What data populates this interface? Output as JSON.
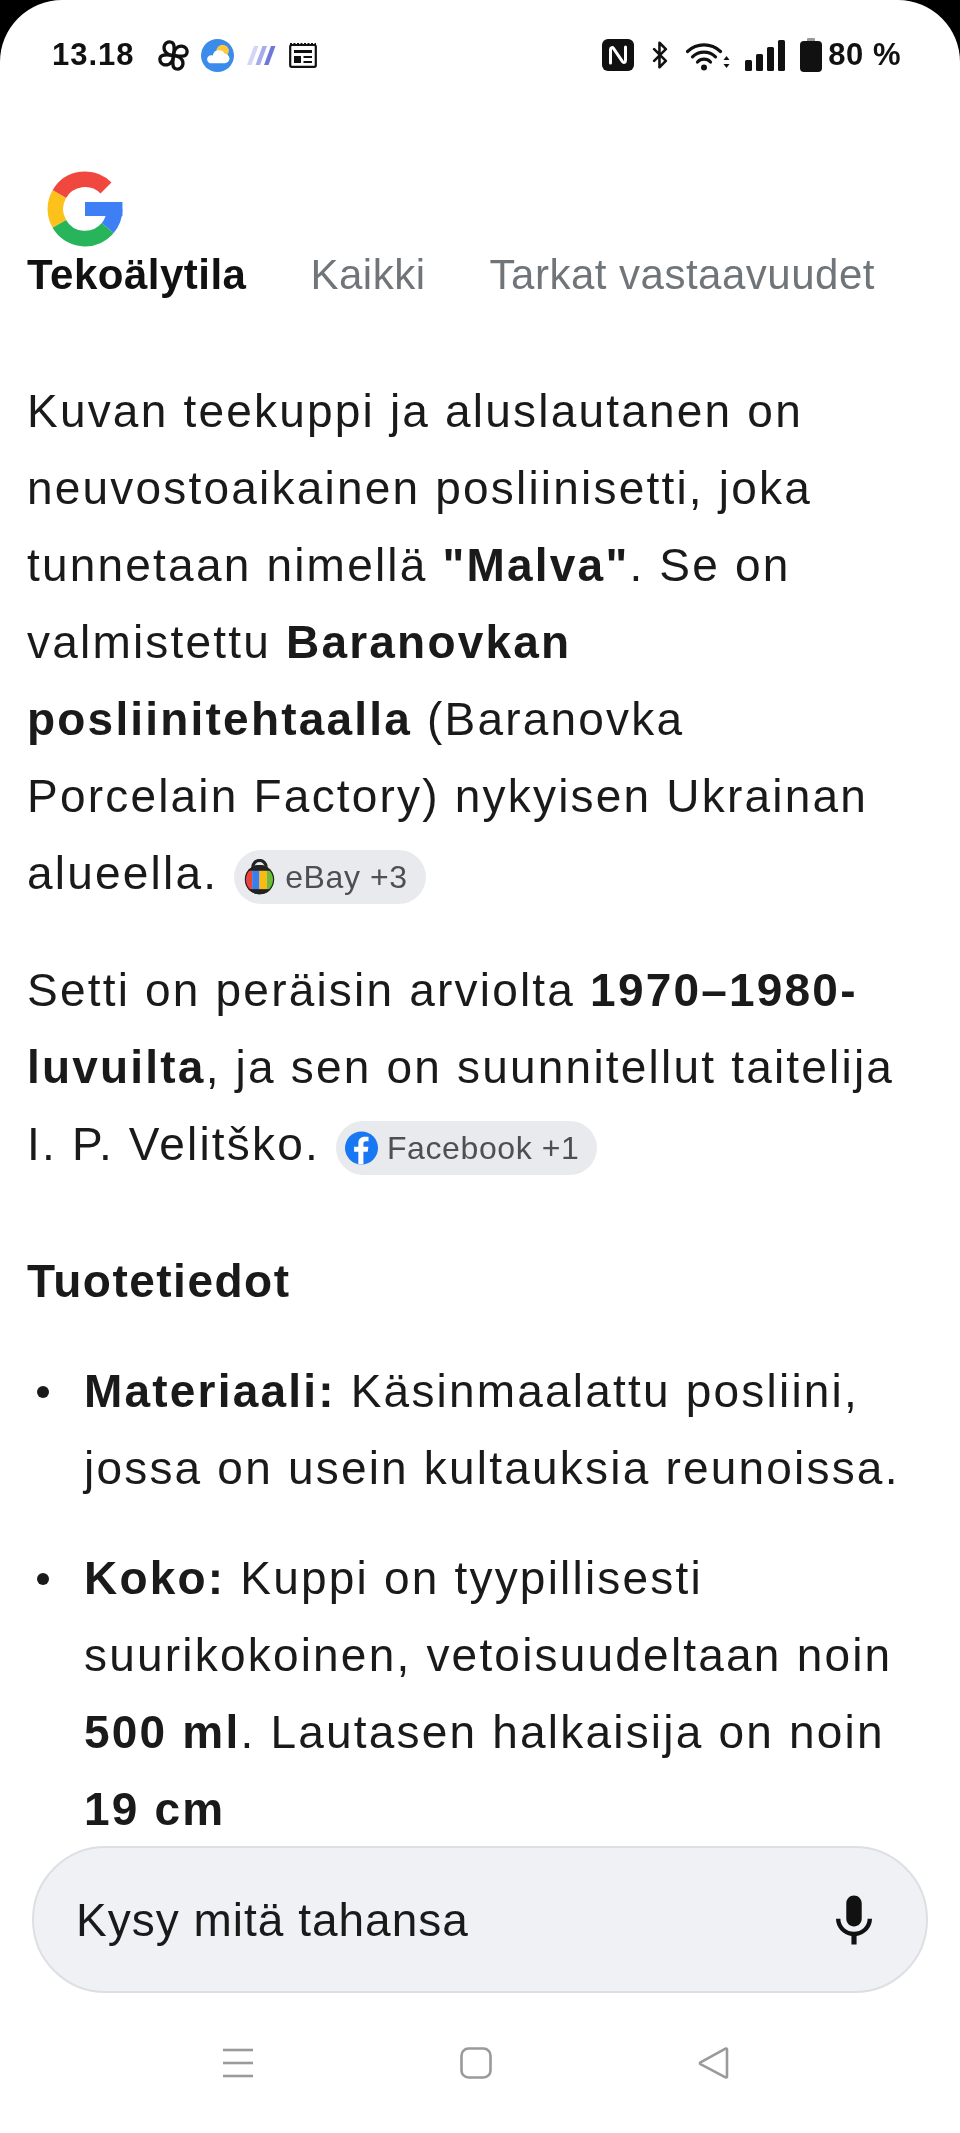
{
  "status_bar": {
    "time": "13.18",
    "battery": "80 %"
  },
  "tabs": [
    {
      "label": "Tekoälytila",
      "selected": true
    },
    {
      "label": "Kaikki",
      "selected": false
    },
    {
      "label": "Tarkat vastaavuudet",
      "selected": false
    }
  ],
  "answer": {
    "paragraphs": [
      {
        "text": "Kuvan teekuppi ja aluslautanen on neuvostoaikainen posliinisetti, joka tunnetaan nimellä **\"Malva\"**. Se on valmistettu **Baranovkan posliinitehtaalla** (Baranovka Porcelain Factory) nykyisen Ukrainan alueella.",
        "source": {
          "label": "eBay +3",
          "kind": "shopping"
        }
      },
      {
        "text": "Setti on peräisin arviolta **1970–1980-luvuilta**, ja sen on suunnitellut taitelija I. P. Velitško.",
        "source": {
          "label": "Facebook +1",
          "kind": "facebook"
        }
      }
    ],
    "section": {
      "heading": "Tuotetiedot",
      "bullets": [
        "**Materiaali:** Käsinmaalattu posliini, jossa on usein kultauksia reunoissa.",
        "**Koko:** Kuppi on tyypillisesti suurikokoinen, vetoisuudeltaan noin **500 ml**. Lautasen halkaisija on noin **19 cm**"
      ]
    }
  },
  "ask_bar": {
    "placeholder": "Kysy mitä tahansa"
  }
}
